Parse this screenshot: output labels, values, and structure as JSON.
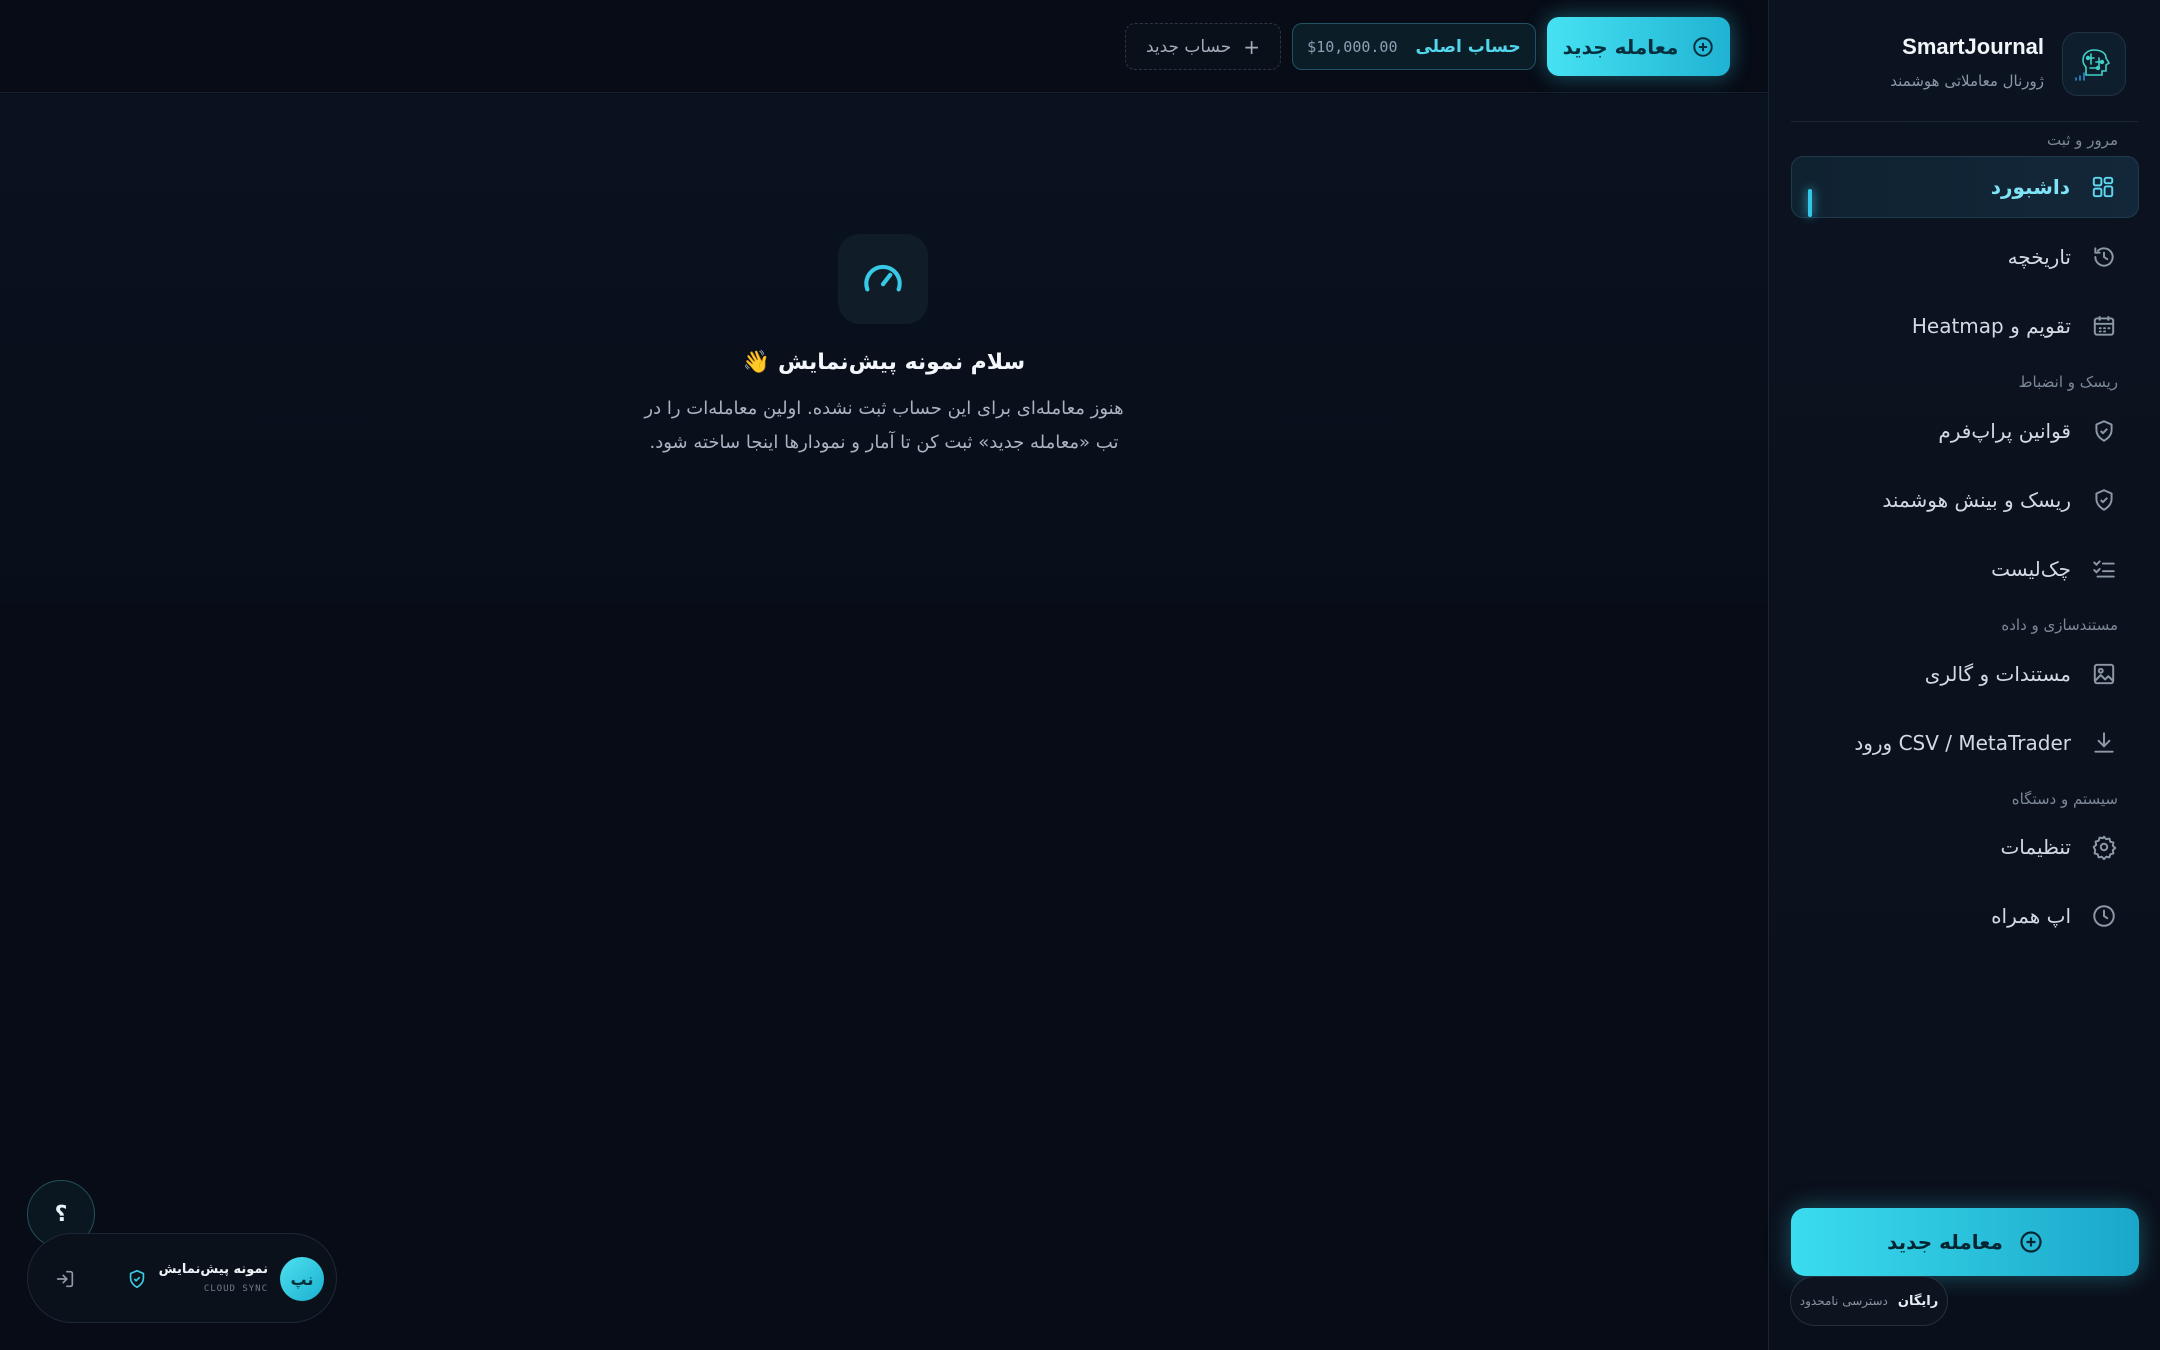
{
  "brand": {
    "name": "SmartJournal",
    "subtitle": "ژورنال معاملاتی هوشمند"
  },
  "sidebar": {
    "sections": [
      {
        "title": "مرور و ثبت"
      },
      {
        "title": "ریسک و انضباط"
      },
      {
        "title": "مستندسازی و داده"
      },
      {
        "title": "سیستم و دستگاه"
      }
    ],
    "items": [
      {
        "label": "داشبورد",
        "icon": "grid-icon",
        "active": true
      },
      {
        "label": "تاریخچه",
        "icon": "history-icon"
      },
      {
        "label": "تقویم و Heatmap",
        "icon": "calendar-icon"
      },
      {
        "label": "قوانین پراپ‌فرم",
        "icon": "shield-check-icon"
      },
      {
        "label": "ریسک و بینش هوشمند",
        "icon": "shield-check-icon"
      },
      {
        "label": "چک‌لیست",
        "icon": "checklist-icon"
      },
      {
        "label": "مستندات و گالری",
        "icon": "image-icon"
      },
      {
        "label": "CSV / MetaTrader ورود",
        "icon": "download-icon"
      },
      {
        "label": "تنظیمات",
        "icon": "gear-icon"
      },
      {
        "label": "اپ همراه",
        "icon": "clock-icon"
      }
    ],
    "cta_label": "معامله جدید",
    "plan": {
      "name": "رایگان",
      "desc": "دسترسی نامحدود"
    }
  },
  "topbar": {
    "new_trade_label": "معامله جدید",
    "account_name": "حساب اصلی",
    "account_balance": "$10,000.00",
    "new_account_label": "حساب جدید"
  },
  "empty_state": {
    "icon": "gauge-icon",
    "title": "سلام نمونه پیش‌نمایش 👋",
    "text_line1": "هنوز معامله‌ای برای این حساب ثبت نشده. اولین معامله‌ات را در",
    "text_line2": "تب «معامله جدید» ثبت کن تا آمار و نمودارها اینجا ساخته شود."
  },
  "user": {
    "help_label": "؟",
    "avatar_initials": "نپ",
    "name": "نمونه پیش‌نمایش",
    "sync_label": "CLOUD SYNC"
  },
  "colors": {
    "accent": "#35c8e6",
    "background": "#070c16",
    "sidebar": "#0b111c"
  }
}
